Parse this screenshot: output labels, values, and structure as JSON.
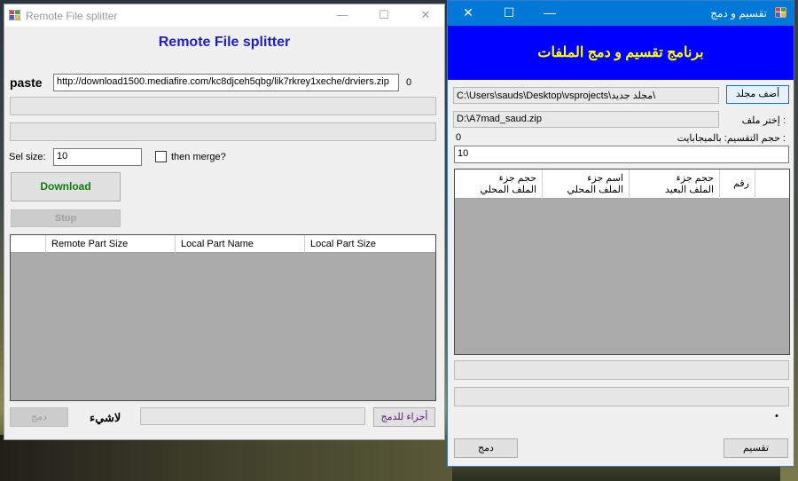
{
  "window1": {
    "title": "Remote File splitter",
    "heading": "Remote File splitter",
    "paste_label": "paste",
    "url_value": "http://download1500.mediafire.com/kc8djceh5qbg/lik7rkrey1xeche/drviers.zip",
    "url_counter": "0",
    "sel_size_label": "Sel size:",
    "sel_size_value": "10",
    "then_merge_label": "then merge?",
    "download_label": "Download",
    "stop_label": "Stop",
    "grid_columns": [
      "",
      "Remote Part Size",
      "Local Part Name",
      "Local Part Size"
    ],
    "merge_label": "دمج",
    "nothing_label": "لاشيء",
    "parts_to_merge_label": "أجزاء للدمج"
  },
  "window2": {
    "title": "تقسيم و دمج",
    "banner": "برنامج تقسيم و دمج الملفات",
    "folder_path": "C:\\Users\\sauds\\Desktop\\vsprojects\\مجلد جديد\\",
    "add_folder_label": "أضف مجلد",
    "file_path": "D:\\A7mad_saud.zip",
    "choose_file_label": "إختر ملف :",
    "split_size_label": "حجم التقسيم: بالميجابايت :",
    "split_size_counter": "0",
    "split_size_value": "10",
    "grid_columns": [
      {
        "line1": "رقم",
        "line2": ""
      },
      {
        "line1": "حجم جزء",
        "line2": "الملف البعيد"
      },
      {
        "line1": "اسم جزء",
        "line2": "الملف المحلي"
      },
      {
        "line1": "حجم جزء",
        "line2": "الملف المحلي"
      }
    ],
    "dot": "•",
    "merge_label": "دمج",
    "split_label": "تقسيم"
  },
  "colors": {
    "banner_bg": "#0000ff",
    "banner_text": "#ffff00",
    "heading_blue": "#1e1ec8",
    "download_green": "#0b7d0b",
    "titlebar_blue": "#0078d7"
  }
}
